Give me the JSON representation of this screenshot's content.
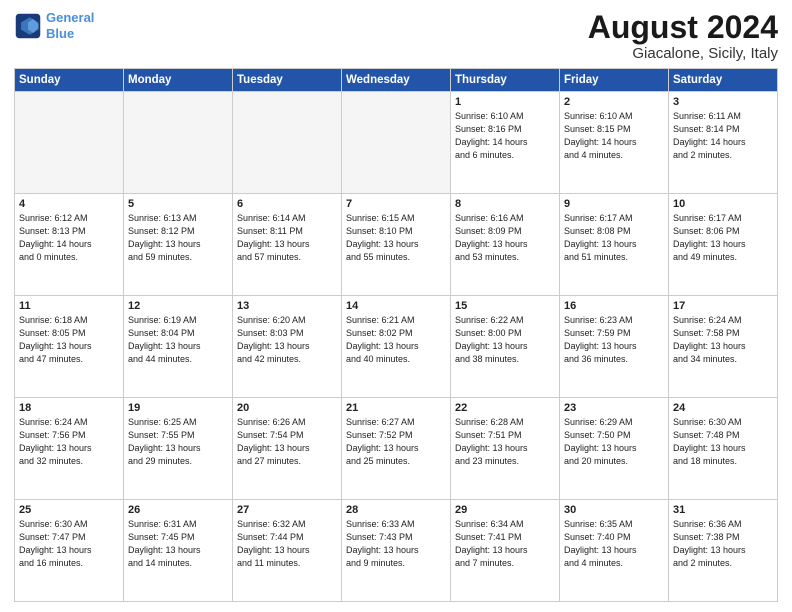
{
  "logo": {
    "line1": "General",
    "line2": "Blue"
  },
  "title": "August 2024",
  "subtitle": "Giacalone, Sicily, Italy",
  "days_header": [
    "Sunday",
    "Monday",
    "Tuesday",
    "Wednesday",
    "Thursday",
    "Friday",
    "Saturday"
  ],
  "weeks": [
    [
      {
        "day": "",
        "info": ""
      },
      {
        "day": "",
        "info": ""
      },
      {
        "day": "",
        "info": ""
      },
      {
        "day": "",
        "info": ""
      },
      {
        "day": "1",
        "info": "Sunrise: 6:10 AM\nSunset: 8:16 PM\nDaylight: 14 hours\nand 6 minutes."
      },
      {
        "day": "2",
        "info": "Sunrise: 6:10 AM\nSunset: 8:15 PM\nDaylight: 14 hours\nand 4 minutes."
      },
      {
        "day": "3",
        "info": "Sunrise: 6:11 AM\nSunset: 8:14 PM\nDaylight: 14 hours\nand 2 minutes."
      }
    ],
    [
      {
        "day": "4",
        "info": "Sunrise: 6:12 AM\nSunset: 8:13 PM\nDaylight: 14 hours\nand 0 minutes."
      },
      {
        "day": "5",
        "info": "Sunrise: 6:13 AM\nSunset: 8:12 PM\nDaylight: 13 hours\nand 59 minutes."
      },
      {
        "day": "6",
        "info": "Sunrise: 6:14 AM\nSunset: 8:11 PM\nDaylight: 13 hours\nand 57 minutes."
      },
      {
        "day": "7",
        "info": "Sunrise: 6:15 AM\nSunset: 8:10 PM\nDaylight: 13 hours\nand 55 minutes."
      },
      {
        "day": "8",
        "info": "Sunrise: 6:16 AM\nSunset: 8:09 PM\nDaylight: 13 hours\nand 53 minutes."
      },
      {
        "day": "9",
        "info": "Sunrise: 6:17 AM\nSunset: 8:08 PM\nDaylight: 13 hours\nand 51 minutes."
      },
      {
        "day": "10",
        "info": "Sunrise: 6:17 AM\nSunset: 8:06 PM\nDaylight: 13 hours\nand 49 minutes."
      }
    ],
    [
      {
        "day": "11",
        "info": "Sunrise: 6:18 AM\nSunset: 8:05 PM\nDaylight: 13 hours\nand 47 minutes."
      },
      {
        "day": "12",
        "info": "Sunrise: 6:19 AM\nSunset: 8:04 PM\nDaylight: 13 hours\nand 44 minutes."
      },
      {
        "day": "13",
        "info": "Sunrise: 6:20 AM\nSunset: 8:03 PM\nDaylight: 13 hours\nand 42 minutes."
      },
      {
        "day": "14",
        "info": "Sunrise: 6:21 AM\nSunset: 8:02 PM\nDaylight: 13 hours\nand 40 minutes."
      },
      {
        "day": "15",
        "info": "Sunrise: 6:22 AM\nSunset: 8:00 PM\nDaylight: 13 hours\nand 38 minutes."
      },
      {
        "day": "16",
        "info": "Sunrise: 6:23 AM\nSunset: 7:59 PM\nDaylight: 13 hours\nand 36 minutes."
      },
      {
        "day": "17",
        "info": "Sunrise: 6:24 AM\nSunset: 7:58 PM\nDaylight: 13 hours\nand 34 minutes."
      }
    ],
    [
      {
        "day": "18",
        "info": "Sunrise: 6:24 AM\nSunset: 7:56 PM\nDaylight: 13 hours\nand 32 minutes."
      },
      {
        "day": "19",
        "info": "Sunrise: 6:25 AM\nSunset: 7:55 PM\nDaylight: 13 hours\nand 29 minutes."
      },
      {
        "day": "20",
        "info": "Sunrise: 6:26 AM\nSunset: 7:54 PM\nDaylight: 13 hours\nand 27 minutes."
      },
      {
        "day": "21",
        "info": "Sunrise: 6:27 AM\nSunset: 7:52 PM\nDaylight: 13 hours\nand 25 minutes."
      },
      {
        "day": "22",
        "info": "Sunrise: 6:28 AM\nSunset: 7:51 PM\nDaylight: 13 hours\nand 23 minutes."
      },
      {
        "day": "23",
        "info": "Sunrise: 6:29 AM\nSunset: 7:50 PM\nDaylight: 13 hours\nand 20 minutes."
      },
      {
        "day": "24",
        "info": "Sunrise: 6:30 AM\nSunset: 7:48 PM\nDaylight: 13 hours\nand 18 minutes."
      }
    ],
    [
      {
        "day": "25",
        "info": "Sunrise: 6:30 AM\nSunset: 7:47 PM\nDaylight: 13 hours\nand 16 minutes."
      },
      {
        "day": "26",
        "info": "Sunrise: 6:31 AM\nSunset: 7:45 PM\nDaylight: 13 hours\nand 14 minutes."
      },
      {
        "day": "27",
        "info": "Sunrise: 6:32 AM\nSunset: 7:44 PM\nDaylight: 13 hours\nand 11 minutes."
      },
      {
        "day": "28",
        "info": "Sunrise: 6:33 AM\nSunset: 7:43 PM\nDaylight: 13 hours\nand 9 minutes."
      },
      {
        "day": "29",
        "info": "Sunrise: 6:34 AM\nSunset: 7:41 PM\nDaylight: 13 hours\nand 7 minutes."
      },
      {
        "day": "30",
        "info": "Sunrise: 6:35 AM\nSunset: 7:40 PM\nDaylight: 13 hours\nand 4 minutes."
      },
      {
        "day": "31",
        "info": "Sunrise: 6:36 AM\nSunset: 7:38 PM\nDaylight: 13 hours\nand 2 minutes."
      }
    ]
  ]
}
